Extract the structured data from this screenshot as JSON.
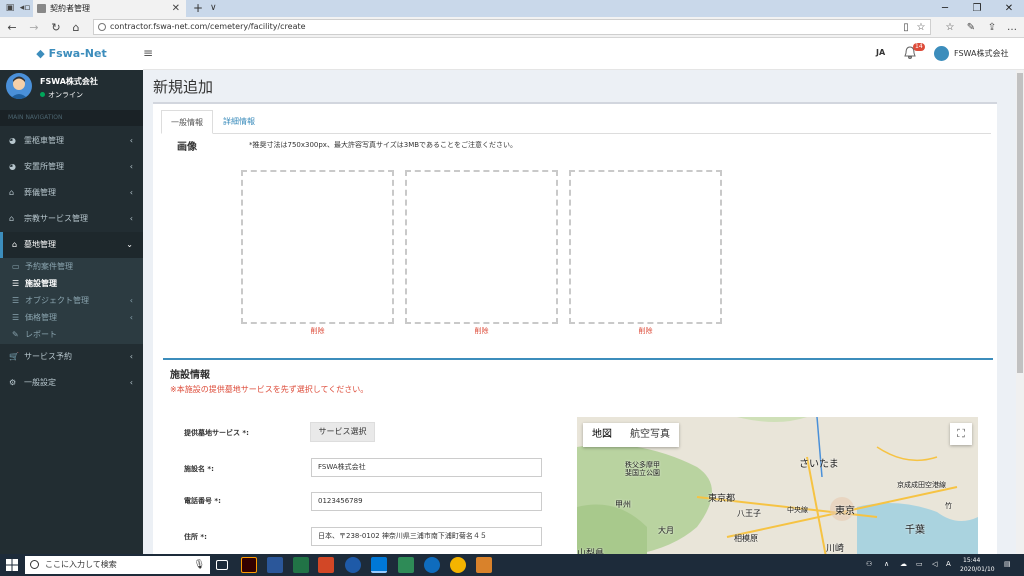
{
  "browser": {
    "tab_title": "契約者管理",
    "url": "contractor.fswa-net.com/cemetery/facility/create"
  },
  "header": {
    "brand": "Fswa-Net",
    "lang": "JA",
    "notif_count": "14",
    "user_name": "FSWA株式会社"
  },
  "sidebar": {
    "user_name": "FSWA株式会社",
    "status": "オンライン",
    "nav_header": "MAIN NAVIGATION",
    "items": [
      {
        "label": "霊柩車管理"
      },
      {
        "label": "安置所管理"
      },
      {
        "label": "葬儀管理"
      },
      {
        "label": "宗教サービス管理"
      },
      {
        "label": "墓地管理"
      },
      {
        "label": "サービス予約"
      },
      {
        "label": "一般設定"
      }
    ],
    "sub_items": [
      {
        "label": "予約案件管理"
      },
      {
        "label": "施設管理"
      },
      {
        "label": "オブジェクト管理"
      },
      {
        "label": "価格管理"
      },
      {
        "label": "レポート"
      }
    ]
  },
  "page": {
    "title": "新規追加",
    "tabs": [
      {
        "label": "一般情報"
      },
      {
        "label": "詳細情報"
      }
    ],
    "image_label": "画像",
    "image_note": "*推奨寸法は750x300px、最大許容写真サイズは3MBであることをご注意ください。",
    "delete_label": "削除",
    "section_title": "施設情報",
    "section_warning": "※本施設の提供墓地サービスを先ず選択してください。",
    "form": {
      "service_label": "提供墓地サービス *:",
      "service_button": "サービス選択",
      "name_label": "施設名 *:",
      "name_value": "FSWA株式会社",
      "phone_label": "電話番号 *:",
      "phone_value": "0123456789",
      "address_label": "住所 *:",
      "address_value": "日本、〒238-0102 神奈川県三浦市南下浦町菊名４５"
    },
    "map": {
      "type_map": "地図",
      "type_sat": "航空写真",
      "labels": [
        "秩父多摩甲斐国立公園",
        "さいたま",
        "東京都",
        "八王子",
        "東京",
        "甲州",
        "大月",
        "相模原",
        "川崎",
        "千葉",
        "山梨県",
        "中央線",
        "京成成田空港線",
        "竹"
      ]
    }
  },
  "taskbar": {
    "search_placeholder": "ここに入力して検索",
    "time": "15:44",
    "date": "2020/01/10"
  }
}
